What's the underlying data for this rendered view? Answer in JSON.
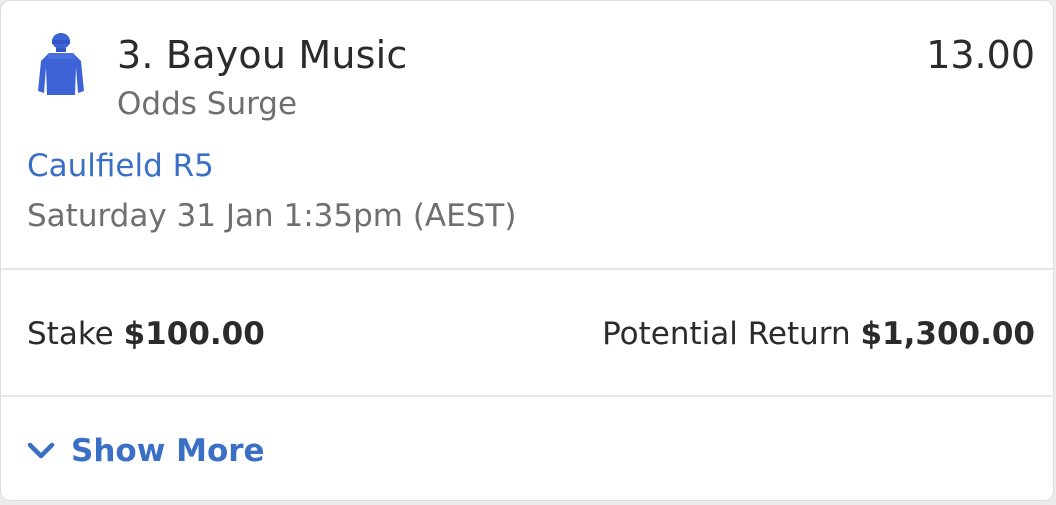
{
  "runner": {
    "name": "3. Bayou Music",
    "bet_type": "Odds Surge",
    "odds": "13.00",
    "silks_icon": "jockey-silks-icon"
  },
  "race": {
    "link_label": "Caulfield R5",
    "time": "Saturday 31 Jan 1:35pm (AEST)"
  },
  "stake": {
    "label": "Stake",
    "amount": "$100.00"
  },
  "potential_return": {
    "label": "Potential Return",
    "amount": "$1,300.00"
  },
  "show_more": {
    "label": "Show More",
    "icon": "chevron-down-icon"
  },
  "colors": {
    "accent": "#3b6fc6",
    "silks": "#3d63d6"
  }
}
